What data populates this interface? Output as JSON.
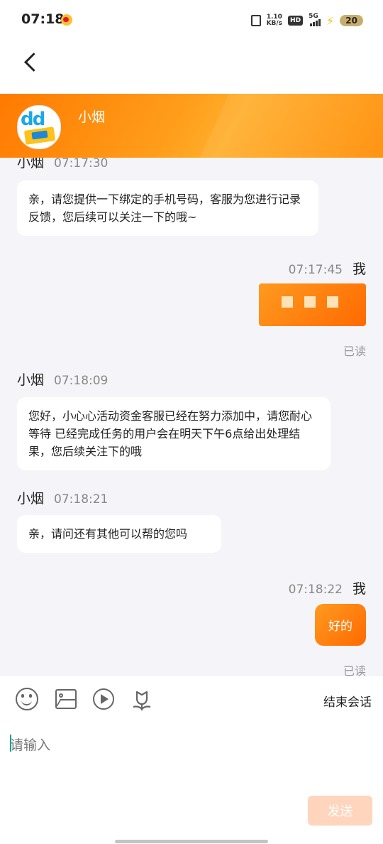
{
  "status_bar": {
    "time": "07:18",
    "speed_value": "1.10",
    "speed_unit": "KB/s",
    "hd": "HD",
    "network": "5G",
    "battery": "20"
  },
  "header": {
    "agent_name": "小烟"
  },
  "messages": [
    {
      "sender": "小烟",
      "time": "07:17:30",
      "text": "亲，请您提供一下绑定的手机号码，客服为您进行记录反馈，您后续可以关注一下的哦~"
    },
    {
      "sender": "我",
      "time": "07:17:45",
      "status": "已读"
    },
    {
      "sender": "小烟",
      "time": "07:18:09",
      "text": "您好，小心心活动资金客服已经在努力添加中，请您耐心等待 已经完成任务的用户会在明天下午6点给出处理结果，您后续关注下的哦"
    },
    {
      "sender": "小烟",
      "time": "07:18:21",
      "text": "亲，请问还有其他可以帮的您吗"
    },
    {
      "sender": "我",
      "time": "07:18:22",
      "text": "好的",
      "status": "已读"
    }
  ],
  "toolbar": {
    "icons": [
      "emoji-icon",
      "image-icon",
      "video-icon",
      "flower-icon"
    ],
    "end_chat_label": "结束会话"
  },
  "input": {
    "placeholder": "请输入",
    "send_label": "发送"
  },
  "colors": {
    "accent": "#ff7a00",
    "bubble_gradient_end": "#ff6a00",
    "send_disabled": "#ffd5bd"
  }
}
